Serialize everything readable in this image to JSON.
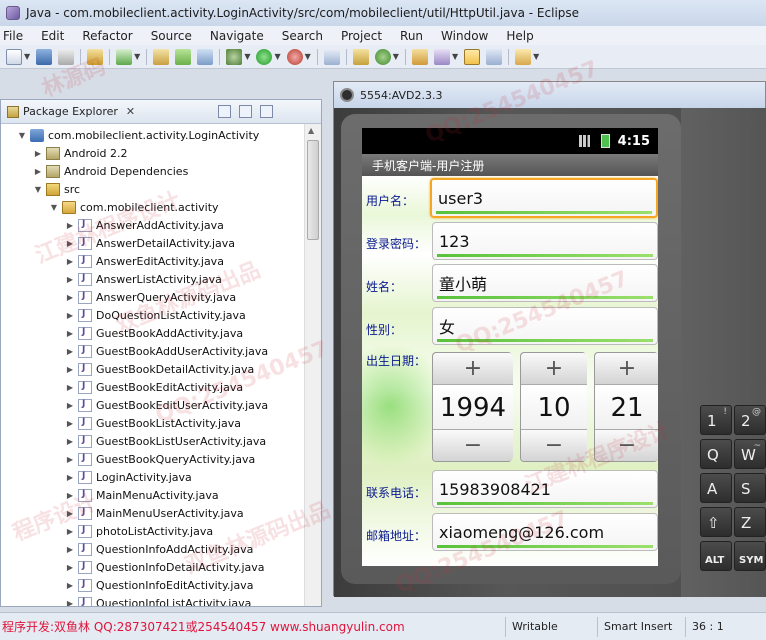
{
  "window": {
    "title": "Java - com.mobileclient.activity.LoginActivity/src/com/mobileclient/util/HttpUtil.java - Eclipse"
  },
  "menu": [
    "File",
    "Edit",
    "Refactor",
    "Source",
    "Navigate",
    "Search",
    "Project",
    "Run",
    "Window",
    "Help"
  ],
  "toolbar_icons": [
    "new-icon",
    "save-icon",
    "print-icon",
    "import-icon",
    "check-icon",
    "package-icon",
    "android-sdk-icon",
    "avd-icon",
    "debug-icon",
    "run-icon",
    "external-tools-icon",
    "new-java-project-icon",
    "new-package-icon",
    "new-class-icon",
    "open-type-icon",
    "search-icon",
    "toggle-mark-icon",
    "pen-icon",
    "next-annotation-icon"
  ],
  "package_explorer": {
    "title": "Package Explorer",
    "close": "✕",
    "tree": [
      {
        "depth": 1,
        "twisty": "▼",
        "icon": "project",
        "label": "com.mobileclient.activity.LoginActivity"
      },
      {
        "depth": 2,
        "twisty": "▶",
        "icon": "lib",
        "label": "Android 2.2"
      },
      {
        "depth": 2,
        "twisty": "▶",
        "icon": "lib",
        "label": "Android Dependencies"
      },
      {
        "depth": 2,
        "twisty": "▼",
        "icon": "src",
        "label": "src"
      },
      {
        "depth": 3,
        "twisty": "▼",
        "icon": "pkg",
        "label": "com.mobileclient.activity"
      },
      {
        "depth": 4,
        "twisty": "▶",
        "icon": "java",
        "label": "AnswerAddActivity.java"
      },
      {
        "depth": 4,
        "twisty": "▶",
        "icon": "java",
        "label": "AnswerDetailActivity.java"
      },
      {
        "depth": 4,
        "twisty": "▶",
        "icon": "java",
        "label": "AnswerEditActivity.java"
      },
      {
        "depth": 4,
        "twisty": "▶",
        "icon": "java",
        "label": "AnswerListActivity.java"
      },
      {
        "depth": 4,
        "twisty": "▶",
        "icon": "java",
        "label": "AnswerQueryActivity.java"
      },
      {
        "depth": 4,
        "twisty": "▶",
        "icon": "java",
        "label": "DoQuestionListActivity.java"
      },
      {
        "depth": 4,
        "twisty": "▶",
        "icon": "java",
        "label": "GuestBookAddActivity.java"
      },
      {
        "depth": 4,
        "twisty": "▶",
        "icon": "java",
        "label": "GuestBookAddUserActivity.java"
      },
      {
        "depth": 4,
        "twisty": "▶",
        "icon": "java",
        "label": "GuestBookDetailActivity.java"
      },
      {
        "depth": 4,
        "twisty": "▶",
        "icon": "java",
        "label": "GuestBookEditActivity.java"
      },
      {
        "depth": 4,
        "twisty": "▶",
        "icon": "java",
        "label": "GuestBookEditUserActivity.java"
      },
      {
        "depth": 4,
        "twisty": "▶",
        "icon": "java",
        "label": "GuestBookListActivity.java"
      },
      {
        "depth": 4,
        "twisty": "▶",
        "icon": "java",
        "label": "GuestBookListUserActivity.java"
      },
      {
        "depth": 4,
        "twisty": "▶",
        "icon": "java",
        "label": "GuestBookQueryActivity.java"
      },
      {
        "depth": 4,
        "twisty": "▶",
        "icon": "java",
        "label": "LoginActivity.java"
      },
      {
        "depth": 4,
        "twisty": "▶",
        "icon": "java",
        "label": "MainMenuActivity.java"
      },
      {
        "depth": 4,
        "twisty": "▶",
        "icon": "java",
        "label": "MainMenuUserActivity.java"
      },
      {
        "depth": 4,
        "twisty": "▶",
        "icon": "java",
        "label": "photoListActivity.java"
      },
      {
        "depth": 4,
        "twisty": "▶",
        "icon": "java",
        "label": "QuestionInfoAddActivity.java"
      },
      {
        "depth": 4,
        "twisty": "▶",
        "icon": "java",
        "label": "QuestionInfoDetailActivity.java"
      },
      {
        "depth": 4,
        "twisty": "▶",
        "icon": "java",
        "label": "QuestionInfoEditActivity.java"
      },
      {
        "depth": 4,
        "twisty": "▶",
        "icon": "java",
        "label": "QuestionInfoListActivity.java"
      }
    ]
  },
  "emulator": {
    "title": "5554:AVD2.3.3",
    "status_time": "4:15",
    "app_title": "手机客户端-用户注册",
    "fields": {
      "username": {
        "label": "用户名：",
        "value": "user3"
      },
      "password": {
        "label": "登录密码：",
        "value": "123"
      },
      "name": {
        "label": "姓名：",
        "value": "童小萌"
      },
      "gender": {
        "label": "性别：",
        "value": "女"
      },
      "birthday": {
        "label": "出生日期：",
        "year": "1994",
        "month": "10",
        "day": "21",
        "plus": "+",
        "minus": "−"
      },
      "phone": {
        "label": "联系电话：",
        "value": "15983908421"
      },
      "email": {
        "label": "邮箱地址：",
        "value": "xiaomeng@126.com"
      }
    },
    "keyboard": [
      {
        "label": "1",
        "alt": "!"
      },
      {
        "label": "2",
        "alt": "@"
      },
      {
        "label": "Q",
        "alt": ""
      },
      {
        "label": "W",
        "alt": "~"
      },
      {
        "label": "A",
        "alt": ""
      },
      {
        "label": "S",
        "alt": ""
      },
      {
        "label": "⇧",
        "alt": ""
      },
      {
        "label": "Z",
        "alt": ""
      },
      {
        "label": "ALT",
        "alt": ""
      },
      {
        "label": "SYM",
        "alt": ""
      }
    ]
  },
  "statusbar": {
    "promo": "程序开发:双鱼林 QQ:287307421或254540457 www.shuangyulin.com",
    "mode": "Writable",
    "insert": "Smart Insert",
    "position": "36 : 1"
  },
  "watermarks": [
    "林源码",
    "QQ:254540457",
    "江建林程序设计",
    "QQ:254540457",
    "双鱼林源码出品",
    "QQ:254540457",
    "程序设计",
    "江建林程序设计",
    "QQ:254540457",
    "双鱼林源码出品"
  ]
}
